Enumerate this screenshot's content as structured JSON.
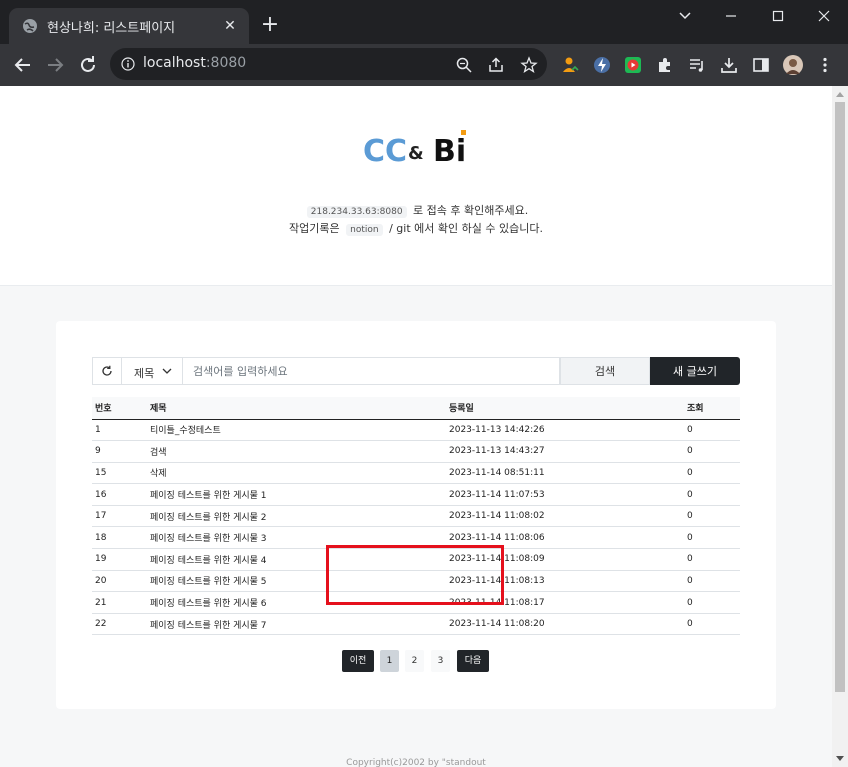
{
  "browser": {
    "tab_title": "현상나희: 리스트페이지",
    "url_host": "localhost",
    "url_port": ":8080"
  },
  "hero": {
    "ip_code": "218.234.33.63:8080",
    "line1_text": "로 접속 후 확인해주세요.",
    "line2_prefix": "작업기록은",
    "notion_code": "notion",
    "line2_suffix": "/ git 에서 확인 하실 수 있습니다.",
    "logo_left": "CC",
    "logo_amp": "&",
    "logo_right": "Bi"
  },
  "search": {
    "select_value": "제목",
    "placeholder": "검색어를 입력하세요",
    "search_label": "검색",
    "write_label": "새 글쓰기"
  },
  "table": {
    "headers": [
      "번호",
      "제목",
      "등록일",
      "조회"
    ],
    "rows": [
      [
        "1",
        "티이틀_수정테스트",
        "2023-11-13 14:42:26",
        "0"
      ],
      [
        "9",
        "검색",
        "2023-11-13 14:43:27",
        "0"
      ],
      [
        "15",
        "삭제",
        "2023-11-14 08:51:11",
        "0"
      ],
      [
        "16",
        "페이징 테스트를 위한 게시물 1",
        "2023-11-14 11:07:53",
        "0"
      ],
      [
        "17",
        "페이징 테스트를 위한 게시물 2",
        "2023-11-14 11:08:02",
        "0"
      ],
      [
        "18",
        "페이징 테스트를 위한 게시물 3",
        "2023-11-14 11:08:06",
        "0"
      ],
      [
        "19",
        "페이징 테스트를 위한 게시물 4",
        "2023-11-14 11:08:09",
        "0"
      ],
      [
        "20",
        "페이징 테스트를 위한 게시물 5",
        "2023-11-14 11:08:13",
        "0"
      ],
      [
        "21",
        "페이징 테스트를 위한 게시물 6",
        "2023-11-14 11:08:17",
        "0"
      ],
      [
        "22",
        "페이징 테스트를 위한 게시물 7",
        "2023-11-14 11:08:20",
        "0"
      ]
    ]
  },
  "pagination": {
    "prev_label": "이전",
    "pages": [
      "1",
      "2",
      "3"
    ],
    "active_page": "1",
    "next_label": "다음"
  },
  "footer": {
    "text": "Copyright(c)2002 by \"standout"
  },
  "colors": {
    "accent_dark": "#212529",
    "logo_blue": "#5b9bd5",
    "logo_orange": "#f39c12",
    "highlight_red": "#e5101c"
  }
}
